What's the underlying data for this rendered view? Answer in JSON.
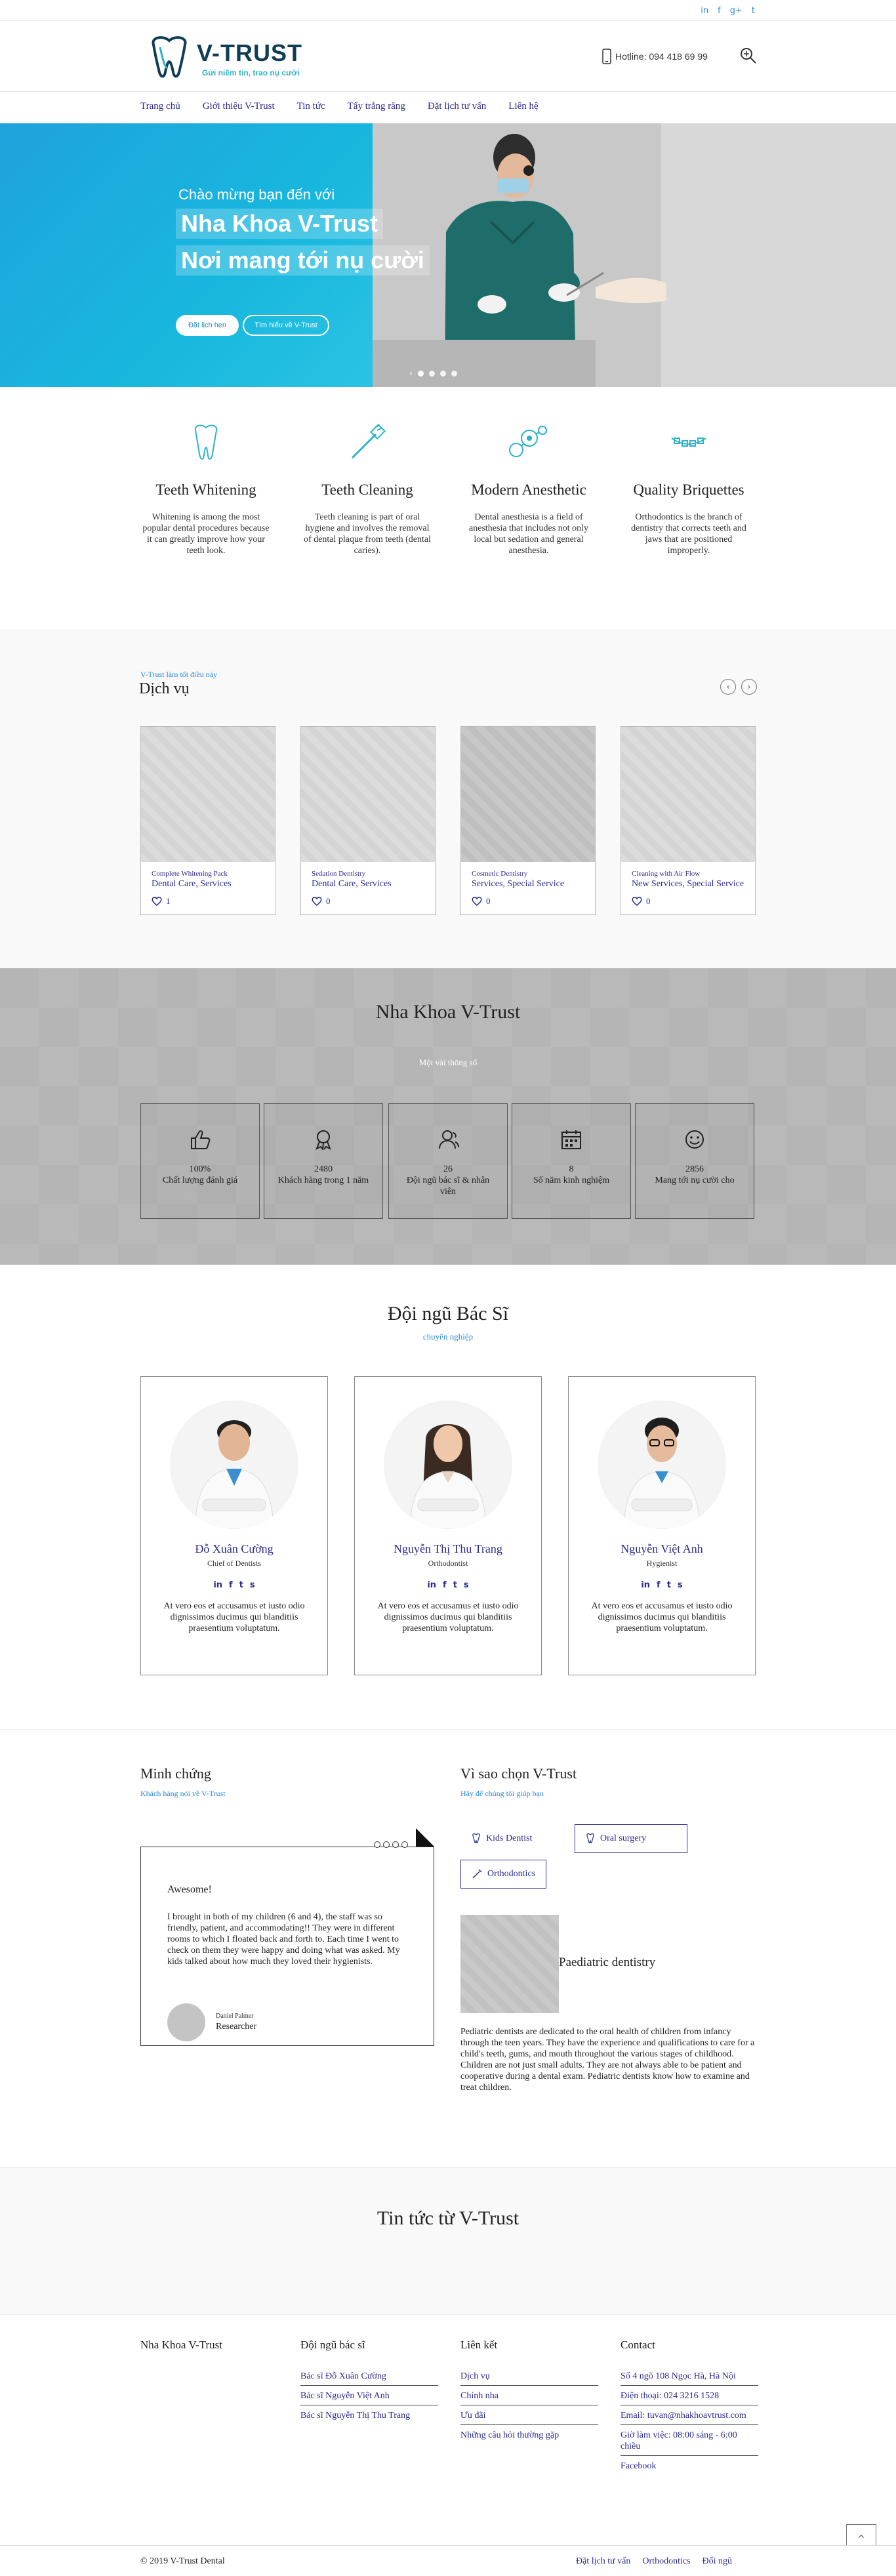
{
  "colors": {
    "accent": "#2a2a8c",
    "link_blue": "#2a8ad6",
    "hero_blue": "#1fa3dc",
    "teal": "#2bb3c9",
    "logo_navy": "#0f3d56"
  },
  "topbar": {
    "social": [
      "in",
      "f",
      "g+",
      "t"
    ]
  },
  "header": {
    "logo_title": "V-TRUST",
    "logo_tagline": "Gửi niềm tin, trao nụ cười",
    "hotline": "Hotline: 094 418 69 99"
  },
  "nav": {
    "items": [
      "Trang chủ",
      "Giới thiệu V-Trust",
      "Tin tức",
      "Tẩy trắng răng",
      "Đặt lịch tư vấn",
      "Liên hệ"
    ]
  },
  "hero": {
    "welcome": "Chào mừng bạn đến với",
    "line1": "Nha Khoa V-Trust",
    "line2": "Nơi mang tới nụ cười",
    "btn_booking": "Đặt lịch hẹn",
    "btn_about": "Tìm hiểu về V-Trust"
  },
  "features": [
    {
      "icon": "tooth-icon",
      "title": "Teeth Whitening",
      "text": "Whitening is among the most popular dental procedures because it can greatly improve how your teeth look."
    },
    {
      "icon": "toothbrush-icon",
      "title": "Teeth Cleaning",
      "text": "Teeth cleaning is part of oral hygiene and involves the removal of dental plaque from teeth (dental caries)."
    },
    {
      "icon": "anesthesia-icon",
      "title": "Modern Anesthetic",
      "text": "Dental anesthesia is a field of anesthesia that includes not only local but sedation and general anesthesia."
    },
    {
      "icon": "braces-icon",
      "title": "Quality Briquettes",
      "text": "Orthodontics is the branch of dentistry that corrects teeth and jaws that are positioned improperly."
    }
  ],
  "services": {
    "small": "V-Trust làm tốt điều này",
    "title": "Dịch vụ",
    "cards": [
      {
        "category": "Complete Whitening Pack",
        "name": "Dental Care, Services",
        "likes": "1"
      },
      {
        "category": "Sedation Dentistry",
        "name": "Dental Care, Services",
        "likes": "0"
      },
      {
        "category": "Cosmetic Dentistry",
        "name": "Services, Special Service",
        "likes": "0"
      },
      {
        "category": "Cleaning with Air Flow",
        "name": "New Services, Special Service",
        "likes": "0"
      }
    ]
  },
  "stats": {
    "title": "Nha Khoa V-Trust",
    "subtitle": "Một vài thông số",
    "items": [
      {
        "icon": "thumbs-up-icon",
        "value": "100%",
        "label": "Chất lượng đánh giá"
      },
      {
        "icon": "award-icon",
        "value": "2480",
        "label": "Khách hàng trong 1 năm"
      },
      {
        "icon": "users-icon",
        "value": "26",
        "label": "Đội ngũ bác sĩ & nhân viên"
      },
      {
        "icon": "calendar-icon",
        "value": "8",
        "label": "Số năm kinh nghiệm"
      },
      {
        "icon": "smile-icon",
        "value": "2856",
        "label": "Mang tới nụ cười cho"
      }
    ]
  },
  "doctors": {
    "title": "Đội ngũ Bác Sĩ",
    "subtitle": "chuyên nghiệp",
    "social": [
      "in",
      "f",
      "t",
      "s"
    ],
    "items": [
      {
        "name": "Đỗ Xuân Cường",
        "role": "Chief of Dentists",
        "desc": "At vero eos et accusamus et iusto odio dignissimos ducimus qui blanditiis praesentium voluptatum."
      },
      {
        "name": "Nguyễn Thị Thu Trang",
        "role": "Orthodontist",
        "desc": "At vero eos et accusamus et iusto odio dignissimos ducimus qui blanditiis praesentium voluptatum."
      },
      {
        "name": "Nguyễn Việt Anh",
        "role": "Hygienist",
        "desc": "At vero eos et accusamus et iusto odio dignissimos ducimus qui blanditiis praesentium voluptatum."
      }
    ]
  },
  "testimonials": {
    "title": "Minh chứng",
    "subtitle": "Khách hàng nói về V-Trust",
    "quote_title": "Awesome!",
    "quote": "I brought in both of my children (6 and 4), the staff was so friendly, patient, and accommodating!! They were in different rooms to which I floated back and forth to. Each time I went to check on them they were happy and doing what was asked. My kids talked about how much they loved their hygienists.",
    "author_name": "Daniel Palmer",
    "author_role": "Researcher"
  },
  "why": {
    "title": "Vì sao chọn V-Trust",
    "subtitle": "Hãy để chúng tôi giúp bạn",
    "tabs": [
      "Kids Dentist",
      "Oral surgery",
      "Orthodontics"
    ],
    "caption": "Paediatric dentistry",
    "text": "Pediatric dentists are dedicated to the oral health of children from infancy through the teen years. They have the experience and qualifications to care for a child's teeth, gums, and mouth throughout the various stages of childhood. Children are not just small adults. They are not always able to be patient and cooperative during a dental exam. Pediatric dentists know how to examine and treat children."
  },
  "news": {
    "title": "Tin tức từ V-Trust"
  },
  "footer": {
    "col1": {
      "title": "Nha Khoa V-Trust"
    },
    "col2": {
      "title": "Đội ngũ bác sĩ",
      "links": [
        "Bác sĩ Đỗ Xuân Cường",
        "Bác sĩ Nguyễn Việt Anh",
        "Bác sĩ Nguyễn Thị Thu Trang"
      ]
    },
    "col3": {
      "title": "Liên kết",
      "links": [
        "Dịch vụ",
        "Chính nha",
        "Ưu đãi",
        "Những câu hỏi thường gặp"
      ]
    },
    "col4": {
      "title": "Contact",
      "links": [
        "Số 4 ngõ 108 Ngọc Hà, Hà Nội",
        "Điện thoại: 024 3216 1528",
        "Email: tuvan@nhakhoavtrust.com",
        "Giờ làm việc: 08:00 sáng - 6:00 chiều",
        "Facebook"
      ]
    }
  },
  "bottom": {
    "copyright": "© 2019 V-Trust Dental",
    "links": [
      "Đặt lịch tư vấn",
      "Orthodontics",
      "Đối ngũ"
    ]
  }
}
